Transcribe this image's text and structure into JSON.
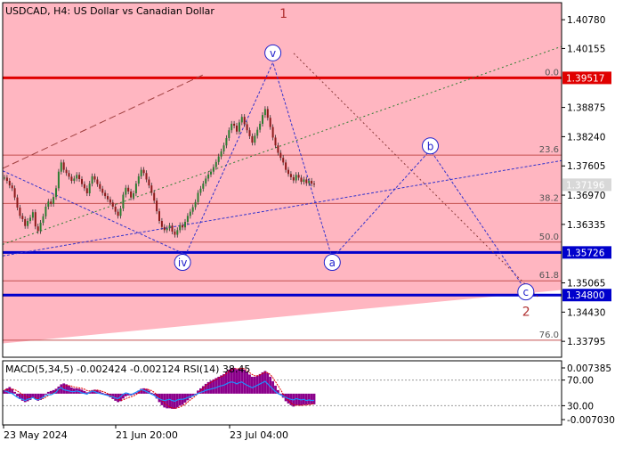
{
  "chart_data": {
    "type": "line",
    "title": "USDCAD, H4:  US Dollar vs Canadian Dollar",
    "symbol": "USDCAD",
    "timeframe": "H4",
    "instrument_name": "US Dollar vs Canadian Dollar",
    "current_price_label": "1.37196",
    "x_labels": [
      "23 May 2024",
      "21 Jun 20:00",
      "23 Jul 04:00"
    ],
    "y_ticks": [
      "1.40780",
      "1.40155",
      "1.38875",
      "1.38240",
      "1.37605",
      "1.36970",
      "1.36335",
      "1.35065",
      "1.34430",
      "1.33795"
    ],
    "ylim": [
      1.3345,
      1.4115
    ],
    "levels": [
      {
        "label": "1.39517",
        "value": 1.39517,
        "color": "#e00000"
      },
      {
        "label": "1.35726",
        "value": 1.35726,
        "color": "#0000cc"
      },
      {
        "label": "1.34800",
        "value": 1.348,
        "color": "#0000cc"
      }
    ],
    "fibonacci": [
      {
        "label": "0.0",
        "value": 1.39517
      },
      {
        "label": "23.6",
        "value": 1.3784
      },
      {
        "label": "38.2",
        "value": 1.3679
      },
      {
        "label": "50.0",
        "value": 1.3595
      },
      {
        "label": "61.8",
        "value": 1.3511
      },
      {
        "label": "76.0",
        "value": 1.3382
      }
    ],
    "wave_labels": {
      "primary": [
        {
          "label": "1",
          "bar": 104,
          "price": 1.4092
        },
        {
          "label": "2",
          "bar": 198,
          "price": 1.3445
        }
      ],
      "minor": [
        {
          "label": "iv",
          "bar": 69,
          "price": 1.3551
        },
        {
          "label": "v",
          "bar": 104,
          "price": 1.4006
        },
        {
          "label": "a",
          "bar": 127,
          "price": 1.3551
        },
        {
          "label": "b",
          "bar": 165,
          "price": 1.3804
        },
        {
          "label": "c",
          "bar": 202,
          "price": 1.3487
        }
      ]
    },
    "price_series": [
      1.3735,
      1.3728,
      1.3718,
      1.3712,
      1.3692,
      1.367,
      1.3652,
      1.3645,
      1.363,
      1.3641,
      1.3648,
      1.366,
      1.3629,
      1.3619,
      1.3637,
      1.3651,
      1.3672,
      1.3683,
      1.3678,
      1.3693,
      1.3712,
      1.3748,
      1.3768,
      1.3752,
      1.3745,
      1.3737,
      1.3728,
      1.3733,
      1.3741,
      1.3732,
      1.3721,
      1.3712,
      1.3701,
      1.3722,
      1.3738,
      1.3731,
      1.3721,
      1.3711,
      1.3702,
      1.3695,
      1.3688,
      1.3681,
      1.3672,
      1.3661,
      1.3652,
      1.3668,
      1.3698,
      1.3713,
      1.3705,
      1.3692,
      1.3701,
      1.3722,
      1.3738,
      1.3752,
      1.3745,
      1.3731,
      1.3718,
      1.3702,
      1.3685,
      1.3662,
      1.3641,
      1.3628,
      1.3621,
      1.3625,
      1.3631,
      1.3618,
      1.3611,
      1.3621,
      1.3632,
      1.3627,
      1.3639,
      1.3652,
      1.3661,
      1.3671,
      1.3682,
      1.3702,
      1.3711,
      1.3722,
      1.3733,
      1.3742,
      1.3748,
      1.3758,
      1.3769,
      1.3781,
      1.3792,
      1.3805,
      1.3821,
      1.3838,
      1.3852,
      1.3848,
      1.3835,
      1.3855,
      1.3867,
      1.3851,
      1.3838,
      1.3825,
      1.3811,
      1.3826,
      1.3839,
      1.3852,
      1.3871,
      1.3884,
      1.3865,
      1.3845,
      1.3822,
      1.3805,
      1.3789,
      1.3778,
      1.3768,
      1.3752,
      1.3743,
      1.3736,
      1.3729,
      1.3741,
      1.3735,
      1.3726,
      1.3731,
      1.3723,
      1.3728,
      1.3722,
      1.372
    ],
    "macd_rsi": {
      "label": "MACD(5,34,5) -0.002424 -0.002124 RSI(14) 38.45",
      "y_ticks": [
        "0.007385",
        "70.00",
        "30.00",
        "-0.007030"
      ],
      "macd_hist": [
        0.0008,
        0.0012,
        0.0015,
        0.0011,
        0.0004,
        -0.0006,
        -0.0012,
        -0.0016,
        -0.0019,
        -0.0017,
        -0.0014,
        -0.001,
        -0.0012,
        -0.0016,
        -0.0014,
        -0.0008,
        -0.0002,
        0.0004,
        0.0006,
        0.0008,
        0.0011,
        0.0016,
        0.0021,
        0.0023,
        0.0021,
        0.0018,
        0.0014,
        0.0012,
        0.0012,
        0.0011,
        0.0009,
        0.0006,
        0.0003,
        0.0004,
        0.0008,
        0.0009,
        0.0008,
        0.0005,
        0.0002,
        -0.0001,
        -0.0004,
        -0.0008,
        -0.0012,
        -0.0016,
        -0.0019,
        -0.0017,
        -0.0011,
        -0.0006,
        -0.0004,
        -0.0004,
        -0.0002,
        0.0002,
        0.0007,
        0.0011,
        0.0012,
        0.0011,
        0.0007,
        0.0002,
        -0.0004,
        -0.0011,
        -0.0019,
        -0.0026,
        -0.0031,
        -0.0033,
        -0.0033,
        -0.0034,
        -0.0034,
        -0.0031,
        -0.0027,
        -0.0025,
        -0.002,
        -0.0015,
        -0.001,
        -0.0005,
        0.0,
        0.0007,
        0.0012,
        0.0017,
        0.0022,
        0.0026,
        0.0029,
        0.0032,
        0.0035,
        0.0038,
        0.0041,
        0.0044,
        0.0049,
        0.0054,
        0.0058,
        0.0058,
        0.0055,
        0.0056,
        0.0058,
        0.0054,
        0.0049,
        0.0043,
        0.0038,
        0.0038,
        0.0041,
        0.0044,
        0.0048,
        0.0051,
        0.0046,
        0.0038,
        0.0028,
        0.0018,
        0.0008,
        -0.0001,
        -0.0009,
        -0.0017,
        -0.0022,
        -0.0026,
        -0.0029,
        -0.0026,
        -0.0026,
        -0.0027,
        -0.0025,
        -0.0025,
        -0.0024,
        -0.0024,
        -0.0024
      ],
      "macd_signal": [
        0.0008,
        0.0009,
        0.001,
        0.001,
        0.0009,
        0.0006,
        0.0002,
        -0.0002,
        -0.0005,
        -0.0008,
        -0.0009,
        -0.0009,
        -0.001,
        -0.0011,
        -0.0012,
        -0.0011,
        -0.0008,
        -0.0004,
        -0.0001,
        0.0002,
        0.0005,
        0.0008,
        0.0012,
        0.0016,
        0.0018,
        0.0018,
        0.0017,
        0.0015,
        0.0014,
        0.0013,
        0.0012,
        0.001,
        0.0007,
        0.0006,
        0.0007,
        0.0007,
        0.0008,
        0.0007,
        0.0005,
        0.0003,
        0.0,
        -0.0003,
        -0.0006,
        -0.001,
        -0.0013,
        -0.0015,
        -0.0014,
        -0.0011,
        -0.0009,
        -0.0007,
        -0.0005,
        -0.0002,
        0.0002,
        0.0006,
        0.0009,
        0.001,
        0.0009,
        0.0007,
        0.0003,
        -0.0002,
        -0.0008,
        -0.0015,
        -0.0021,
        -0.0026,
        -0.003,
        -0.0032,
        -0.0033,
        -0.0032,
        -0.003,
        -0.0027,
        -0.0024,
        -0.0019,
        -0.0014,
        -0.001,
        -0.0005,
        0.0001,
        0.0006,
        0.0012,
        0.0017,
        0.0022,
        0.0025,
        0.0029,
        0.0032,
        0.0035,
        0.0038,
        0.0041,
        0.0045,
        0.005,
        0.0054,
        0.0056,
        0.0056,
        0.0056,
        0.0057,
        0.0056,
        0.0052,
        0.0047,
        0.0043,
        0.004,
        0.004,
        0.0042,
        0.0045,
        0.0048,
        0.0047,
        0.0043,
        0.0036,
        0.0027,
        0.0018,
        0.0009,
        -0.0001,
        -0.0009,
        -0.0015,
        -0.0021,
        -0.0025,
        -0.0026,
        -0.0026,
        -0.0026,
        -0.0026,
        -0.0025,
        -0.0025,
        -0.0024,
        -0.0021
      ],
      "rsi": [
        53.0,
        52.0,
        50.0,
        49.0,
        46.0,
        43.0,
        41.0,
        40.0,
        38.0,
        40.0,
        41.0,
        43.0,
        40.0,
        39.0,
        41.0,
        43.0,
        46.0,
        47.0,
        47.0,
        49.0,
        51.0,
        56.0,
        58.0,
        55.0,
        54.0,
        53.0,
        52.0,
        52.0,
        53.0,
        52.0,
        50.0,
        49.0,
        48.0,
        51.0,
        53.0,
        52.0,
        50.0,
        49.0,
        48.0,
        47.0,
        46.0,
        45.0,
        44.0,
        42.0,
        41.0,
        44.0,
        48.0,
        50.0,
        49.0,
        47.0,
        49.0,
        51.0,
        53.0,
        55.0,
        54.0,
        52.0,
        50.0,
        48.0,
        46.0,
        43.0,
        41.0,
        39.0,
        38.0,
        39.0,
        40.0,
        38.0,
        37.0,
        39.0,
        40.0,
        40.0,
        41.0,
        43.0,
        44.0,
        45.0,
        47.0,
        49.0,
        51.0,
        52.0,
        54.0,
        55.0,
        56.0,
        57.0,
        58.0,
        60.0,
        61.0,
        62.0,
        64.0,
        66.0,
        67.0,
        66.0,
        64.0,
        66.0,
        67.0,
        64.0,
        62.0,
        60.0,
        58.0,
        60.0,
        62.0,
        64.0,
        66.0,
        68.0,
        64.0,
        60.0,
        56.0,
        52.0,
        49.0,
        47.0,
        45.0,
        43.0,
        41.0,
        40.0,
        39.0,
        41.0,
        40.0,
        39.0,
        40.0,
        38.0,
        39.0,
        38.0,
        38.45
      ]
    }
  }
}
